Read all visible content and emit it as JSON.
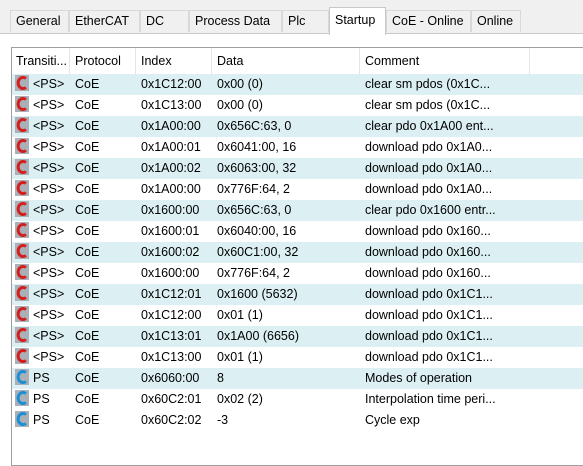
{
  "tabs": [
    {
      "label": "General",
      "active": false
    },
    {
      "label": "EtherCAT",
      "active": false
    },
    {
      "label": "DC",
      "active": false
    },
    {
      "label": "Process Data",
      "active": false
    },
    {
      "label": "Plc",
      "active": false
    },
    {
      "label": "Startup",
      "active": true
    },
    {
      "label": "CoE - Online",
      "active": false
    },
    {
      "label": "Online",
      "active": false
    }
  ],
  "columns": [
    "Transiti...",
    "Protocol",
    "Index",
    "Data",
    "Comment"
  ],
  "rows": [
    {
      "transition": "<PS>",
      "protocol": "CoE",
      "index": "0x1C12:00",
      "data": "0x00 (0)",
      "comment": "clear sm pdos (0x1C...",
      "icon": "coe-red-icon"
    },
    {
      "transition": "<PS>",
      "protocol": "CoE",
      "index": "0x1C13:00",
      "data": "0x00 (0)",
      "comment": "clear sm pdos (0x1C...",
      "icon": "coe-red-icon"
    },
    {
      "transition": "<PS>",
      "protocol": "CoE",
      "index": "0x1A00:00",
      "data": "0x656C:63, 0",
      "comment": "clear pdo 0x1A00 ent...",
      "icon": "coe-red-icon"
    },
    {
      "transition": "<PS>",
      "protocol": "CoE",
      "index": "0x1A00:01",
      "data": "0x6041:00, 16",
      "comment": "download pdo 0x1A0...",
      "icon": "coe-red-icon"
    },
    {
      "transition": "<PS>",
      "protocol": "CoE",
      "index": "0x1A00:02",
      "data": "0x6063:00, 32",
      "comment": "download pdo 0x1A0...",
      "icon": "coe-red-icon"
    },
    {
      "transition": "<PS>",
      "protocol": "CoE",
      "index": "0x1A00:00",
      "data": "0x776F:64, 2",
      "comment": "download pdo 0x1A0...",
      "icon": "coe-red-icon"
    },
    {
      "transition": "<PS>",
      "protocol": "CoE",
      "index": "0x1600:00",
      "data": "0x656C:63, 0",
      "comment": "clear pdo 0x1600 entr...",
      "icon": "coe-red-icon"
    },
    {
      "transition": "<PS>",
      "protocol": "CoE",
      "index": "0x1600:01",
      "data": "0x6040:00, 16",
      "comment": "download pdo 0x160...",
      "icon": "coe-red-icon"
    },
    {
      "transition": "<PS>",
      "protocol": "CoE",
      "index": "0x1600:02",
      "data": "0x60C1:00, 32",
      "comment": "download pdo 0x160...",
      "icon": "coe-red-icon"
    },
    {
      "transition": "<PS>",
      "protocol": "CoE",
      "index": "0x1600:00",
      "data": "0x776F:64, 2",
      "comment": "download pdo 0x160...",
      "icon": "coe-red-icon"
    },
    {
      "transition": "<PS>",
      "protocol": "CoE",
      "index": "0x1C12:01",
      "data": "0x1600 (5632)",
      "comment": "download pdo 0x1C1...",
      "icon": "coe-red-icon"
    },
    {
      "transition": "<PS>",
      "protocol": "CoE",
      "index": "0x1C12:00",
      "data": "0x01 (1)",
      "comment": "download pdo 0x1C1...",
      "icon": "coe-red-icon"
    },
    {
      "transition": "<PS>",
      "protocol": "CoE",
      "index": "0x1C13:01",
      "data": "0x1A00 (6656)",
      "comment": "download pdo 0x1C1...",
      "icon": "coe-red-icon"
    },
    {
      "transition": "<PS>",
      "protocol": "CoE",
      "index": "0x1C13:00",
      "data": "0x01 (1)",
      "comment": "download pdo 0x1C1...",
      "icon": "coe-red-icon"
    },
    {
      "transition": "PS",
      "protocol": "CoE",
      "index": "0x6060:00",
      "data": "8",
      "comment": "Modes of operation",
      "icon": "coe-blue-icon"
    },
    {
      "transition": "PS",
      "protocol": "CoE",
      "index": "0x60C2:01",
      "data": "0x02 (2)",
      "comment": "Interpolation time peri...",
      "icon": "coe-blue-icon"
    },
    {
      "transition": "PS",
      "protocol": "CoE",
      "index": "0x60C2:02",
      "data": "-3",
      "comment": "Cycle exp",
      "icon": "coe-blue-icon"
    }
  ],
  "colors": {
    "row_shade": "#dcf0f4",
    "row_plain": "#ffffff",
    "icon_red": "#d21f1f",
    "icon_blue": "#1a8fd6",
    "icon_gray": "#aab0b6"
  }
}
